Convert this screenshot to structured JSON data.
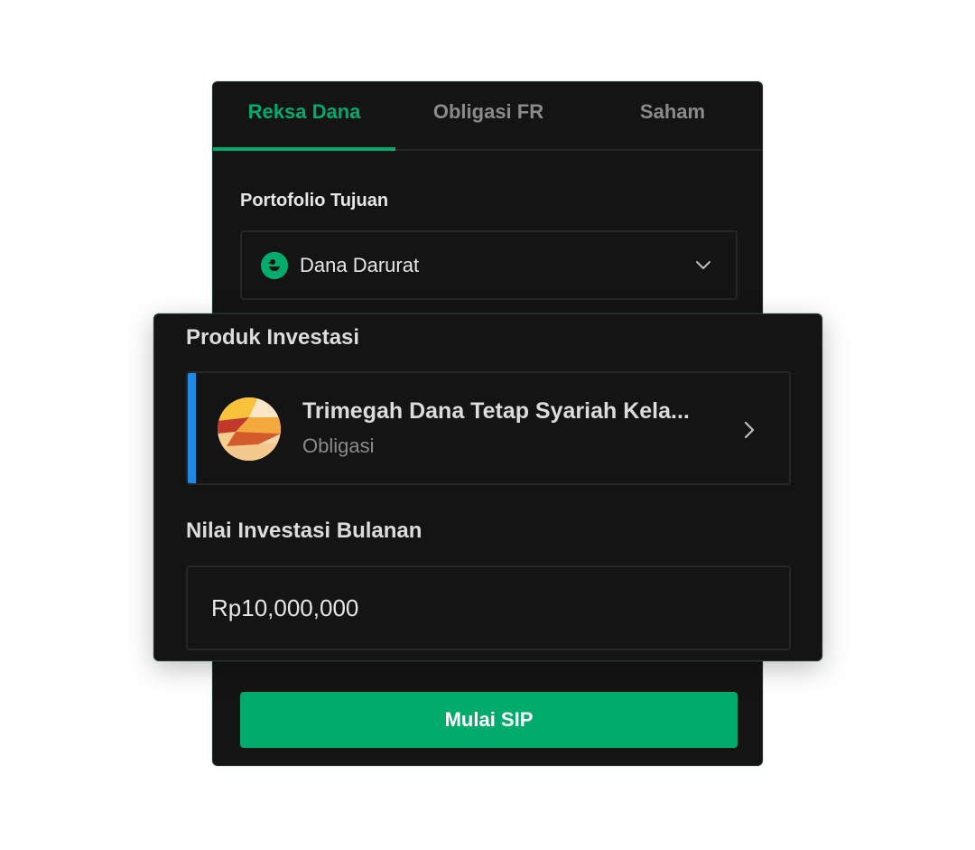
{
  "tabs": [
    {
      "label": "Reksa Dana",
      "active": true
    },
    {
      "label": "Obligasi FR",
      "active": false
    },
    {
      "label": "Saham",
      "active": false
    }
  ],
  "portfolio": {
    "label": "Portofolio Tujuan",
    "selected": "Dana Darurat",
    "icon": "portfolio-goal-icon"
  },
  "product": {
    "label": "Produk Investasi",
    "fund_name": "Trimegah Dana Tetap Syariah Kela...",
    "fund_category": "Obligasi"
  },
  "monthly": {
    "label": "Nilai Investasi Bulanan",
    "value": "Rp10,000,000"
  },
  "cta": {
    "label": "Mulai SIP"
  },
  "colors": {
    "accent": "#00ab6b",
    "background": "#141414",
    "product_accent": "#1e88e5",
    "muted_text": "#8a8a8a"
  }
}
